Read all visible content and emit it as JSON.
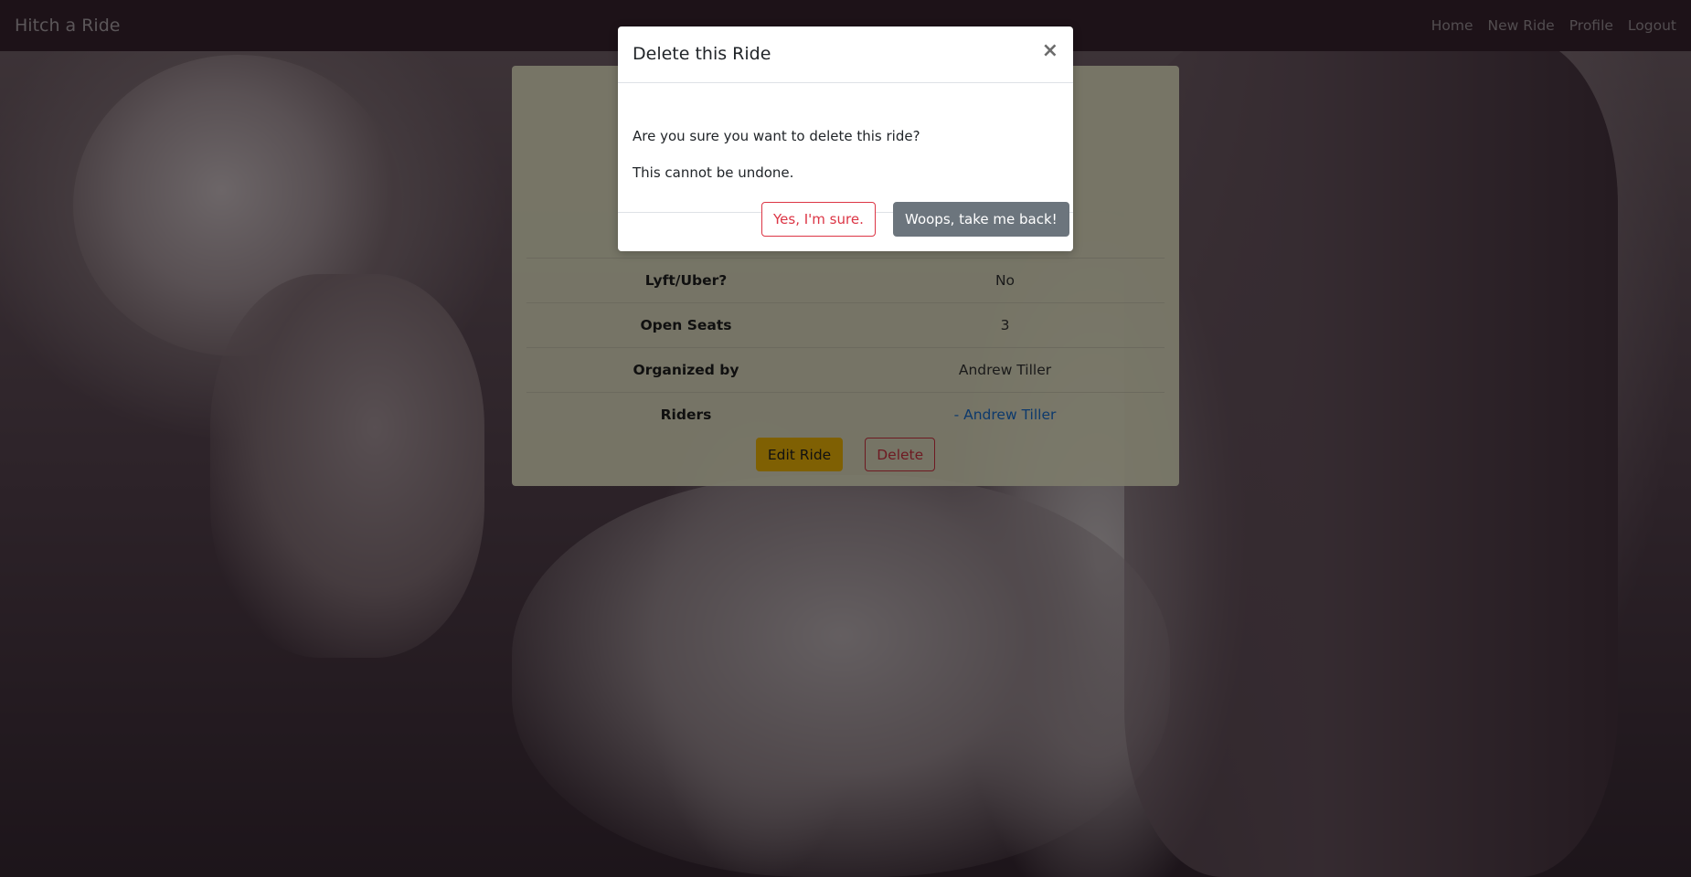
{
  "navbar": {
    "brand": "Hitch a Ride",
    "links": [
      "Home",
      "New Ride",
      "Profile",
      "Logout"
    ]
  },
  "ride": {
    "rows": [
      {
        "label": "Lyft/Uber?",
        "value": "No"
      },
      {
        "label": "Open Seats",
        "value": "3"
      },
      {
        "label": "Organized by",
        "value": "Andrew Tiller"
      },
      {
        "label": "Riders",
        "value": "- Andrew Tiller"
      }
    ],
    "edit_label": "Edit Ride",
    "delete_label": "Delete"
  },
  "modal": {
    "title": "Delete this Ride",
    "close_symbol": "×",
    "message": "Are you sure you want to delete this ride?",
    "warning": "This cannot be undone.",
    "confirm_label": "Yes, I'm sure.",
    "cancel_label": "Woops, take me back!"
  },
  "colors": {
    "navbar_bg": "#3b2531",
    "warning": "#ffc107",
    "danger": "#dc3545",
    "secondary": "#6c757d",
    "link": "#1a73d9"
  }
}
